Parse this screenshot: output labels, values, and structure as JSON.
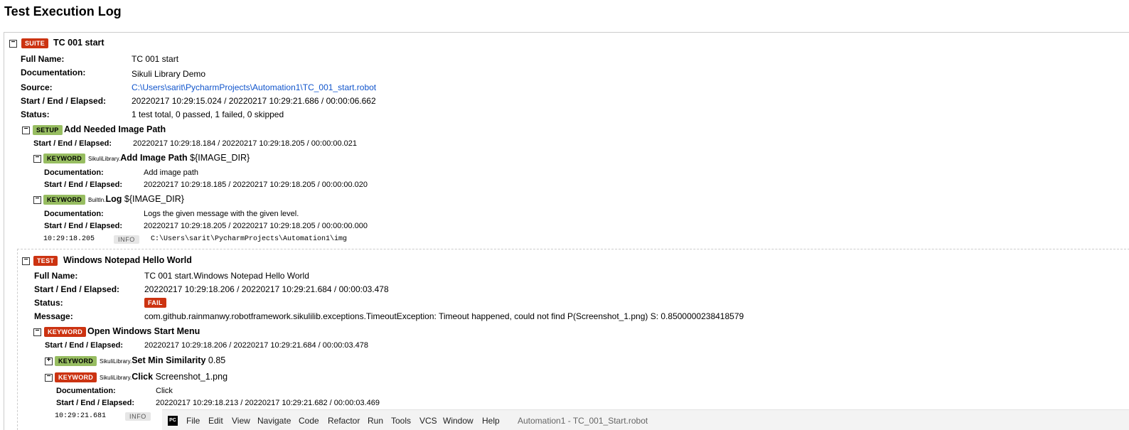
{
  "page": {
    "title": "Test Execution Log"
  },
  "suite": {
    "badge": "SUITE",
    "name": "TC 001 start",
    "labels": {
      "full_name": "Full Name:",
      "documentation": "Documentation:",
      "source": "Source:",
      "elapsed": "Start / End / Elapsed:",
      "status": "Status:"
    },
    "full_name": "TC 001 start",
    "documentation": "Sikuli Library Demo",
    "source": "C:\\Users\\sarit\\PycharmProjects\\Automation1\\TC_001_start.robot",
    "elapsed": "20220217 10:29:15.024 / 20220217 10:29:21.686 / 00:00:06.662",
    "status": "1 test total, 0 passed, 1 failed, 0 skipped"
  },
  "setup": {
    "badge": "SETUP",
    "name": "Add Needed Image Path",
    "label_elapsed": "Start / End / Elapsed:",
    "elapsed": "20220217 10:29:18.184 / 20220217 10:29:18.205 / 00:00:00.021",
    "kw1": {
      "badge": "KEYWORD",
      "lib": "SikuliLibrary.",
      "name": "Add Image Path",
      "args": "${IMAGE_DIR}",
      "label_doc": "Documentation:",
      "doc": "Add image path",
      "label_elapsed": "Start / End / Elapsed:",
      "elapsed": "20220217 10:29:18.185 / 20220217 10:29:18.205 / 00:00:00.020"
    },
    "kw2": {
      "badge": "KEYWORD",
      "lib": "BuiltIn.",
      "name": "Log",
      "args": "${IMAGE_DIR}",
      "label_doc": "Documentation:",
      "doc": "Logs the given message with the given level.",
      "label_elapsed": "Start / End / Elapsed:",
      "elapsed": "20220217 10:29:18.205 / 20220217 10:29:18.205 / 00:00:00.000",
      "msg_time": "10:29:18.205",
      "msg_level": "INFO",
      "msg_text": "C:\\Users\\sarit\\PycharmProjects\\Automation1\\img"
    }
  },
  "test": {
    "badge": "TEST",
    "name": "Windows Notepad Hello World",
    "labels": {
      "full_name": "Full Name:",
      "elapsed": "Start / End / Elapsed:",
      "status": "Status:",
      "message": "Message:"
    },
    "full_name": "TC 001 start.Windows Notepad Hello World",
    "elapsed": "20220217 10:29:18.206 / 20220217 10:29:21.684 / 00:00:03.478",
    "status": "FAIL",
    "message": "com.github.rainmanwy.robotframework.sikulilib.exceptions.TimeoutException: Timeout happened, could not find P(Screenshot_1.png) S: 0.8500000238418579",
    "kw": {
      "badge": "KEYWORD",
      "name": "Open Windows Start Menu",
      "label_elapsed": "Start / End / Elapsed:",
      "elapsed": "20220217 10:29:18.206 / 20220217 10:29:21.684 / 00:00:03.478",
      "sub1": {
        "badge": "KEYWORD",
        "lib": "SikuliLibrary.",
        "name": "Set Min Similarity",
        "args": "0.85"
      },
      "sub2": {
        "badge": "KEYWORD",
        "lib": "SikuliLibrary.",
        "name": "Click",
        "args": "Screenshot_1.png",
        "label_doc": "Documentation:",
        "doc": "Click",
        "label_elapsed": "Start / End / Elapsed:",
        "elapsed": "20220217 10:29:18.213 / 20220217 10:29:21.682 / 00:00:03.469",
        "msg_time": "10:29:21.681",
        "msg_level": "INFO"
      }
    }
  },
  "ide": {
    "menu": [
      "File",
      "Edit",
      "View",
      "Navigate",
      "Code",
      "Refactor",
      "Run",
      "Tools",
      "VCS",
      "Window",
      "Help"
    ],
    "title": "Automation1 - TC_001_Start.robot"
  }
}
